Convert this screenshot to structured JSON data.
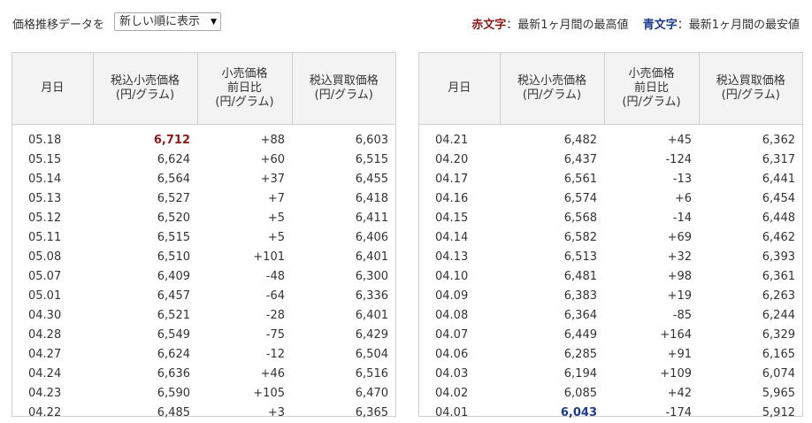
{
  "toolbar": {
    "sort_label": "価格推移データを",
    "sort_selected": "新しい順に表示",
    "legend_red_label": "赤文字",
    "legend_red_desc": "：最新1ヶ月間の最高値",
    "legend_blue_label": "青文字",
    "legend_blue_desc": "：最新1ヶ月間の最安値"
  },
  "colors": {
    "high": "#8b1a1a",
    "low": "#1e3a8a",
    "header_bg": "#f3f3f3"
  },
  "headers": {
    "date": [
      "月日"
    ],
    "retail": [
      "税込小売価格",
      "(円/グラム)"
    ],
    "change": [
      "小売価格",
      "前日比",
      "(円/グラム)"
    ],
    "buy": [
      "税込買取価格",
      "(円/グラム)"
    ]
  },
  "left_rows": [
    {
      "date": "05.18",
      "retail": "6,712",
      "change": "+88",
      "buy": "6,603",
      "mark": "hi"
    },
    {
      "date": "05.15",
      "retail": "6,624",
      "change": "+60",
      "buy": "6,515"
    },
    {
      "date": "05.14",
      "retail": "6,564",
      "change": "+37",
      "buy": "6,455"
    },
    {
      "date": "05.13",
      "retail": "6,527",
      "change": "+7",
      "buy": "6,418"
    },
    {
      "date": "05.12",
      "retail": "6,520",
      "change": "+5",
      "buy": "6,411"
    },
    {
      "date": "05.11",
      "retail": "6,515",
      "change": "+5",
      "buy": "6,406"
    },
    {
      "date": "05.08",
      "retail": "6,510",
      "change": "+101",
      "buy": "6,401"
    },
    {
      "date": "05.07",
      "retail": "6,409",
      "change": "-48",
      "buy": "6,300"
    },
    {
      "date": "05.01",
      "retail": "6,457",
      "change": "-64",
      "buy": "6,336"
    },
    {
      "date": "04.30",
      "retail": "6,521",
      "change": "-28",
      "buy": "6,401"
    },
    {
      "date": "04.28",
      "retail": "6,549",
      "change": "-75",
      "buy": "6,429"
    },
    {
      "date": "04.27",
      "retail": "6,624",
      "change": "-12",
      "buy": "6,504"
    },
    {
      "date": "04.24",
      "retail": "6,636",
      "change": "+46",
      "buy": "6,516"
    },
    {
      "date": "04.23",
      "retail": "6,590",
      "change": "+105",
      "buy": "6,470"
    },
    {
      "date": "04.22",
      "retail": "6,485",
      "change": "+3",
      "buy": "6,365"
    }
  ],
  "right_rows": [
    {
      "date": "04.21",
      "retail": "6,482",
      "change": "+45",
      "buy": "6,362"
    },
    {
      "date": "04.20",
      "retail": "6,437",
      "change": "-124",
      "buy": "6,317"
    },
    {
      "date": "04.17",
      "retail": "6,561",
      "change": "-13",
      "buy": "6,441"
    },
    {
      "date": "04.16",
      "retail": "6,574",
      "change": "+6",
      "buy": "6,454"
    },
    {
      "date": "04.15",
      "retail": "6,568",
      "change": "-14",
      "buy": "6,448"
    },
    {
      "date": "04.14",
      "retail": "6,582",
      "change": "+69",
      "buy": "6,462"
    },
    {
      "date": "04.13",
      "retail": "6,513",
      "change": "+32",
      "buy": "6,393"
    },
    {
      "date": "04.10",
      "retail": "6,481",
      "change": "+98",
      "buy": "6,361"
    },
    {
      "date": "04.09",
      "retail": "6,383",
      "change": "+19",
      "buy": "6,263"
    },
    {
      "date": "04.08",
      "retail": "6,364",
      "change": "-85",
      "buy": "6,244"
    },
    {
      "date": "04.07",
      "retail": "6,449",
      "change": "+164",
      "buy": "6,329"
    },
    {
      "date": "04.06",
      "retail": "6,285",
      "change": "+91",
      "buy": "6,165"
    },
    {
      "date": "04.03",
      "retail": "6,194",
      "change": "+109",
      "buy": "6,074"
    },
    {
      "date": "04.02",
      "retail": "6,085",
      "change": "+42",
      "buy": "5,965"
    },
    {
      "date": "04.01",
      "retail": "6,043",
      "change": "-174",
      "buy": "5,912",
      "mark": "lo"
    }
  ]
}
